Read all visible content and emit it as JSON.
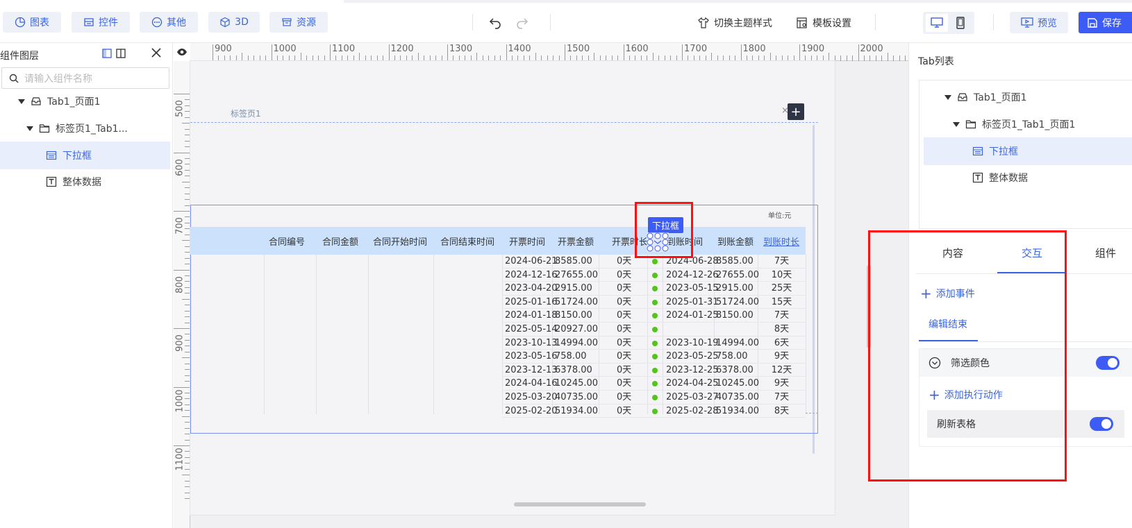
{
  "toolbar": {
    "buttons": [
      {
        "label": "图表",
        "icon": "pie-chart-icon"
      },
      {
        "label": "控件",
        "icon": "widget-icon"
      },
      {
        "label": "其他",
        "icon": "more-circle-icon"
      },
      {
        "label": "3D",
        "icon": "cube-icon"
      },
      {
        "label": "资源",
        "icon": "archive-icon"
      }
    ],
    "theme_label": "切换主题样式",
    "template_label": "模板设置",
    "preview_label": "预览",
    "save_label": "保存"
  },
  "left_panel": {
    "title": "组件图层",
    "search_placeholder": "请输入组件名称",
    "tree": [
      {
        "label": "Tab1_页面1",
        "icon": "inbox-icon"
      },
      {
        "label": "标签页1_Tab1...",
        "icon": "folder-icon"
      },
      {
        "label": "下拉框",
        "icon": "dropdown-component-icon",
        "selected": true
      },
      {
        "label": "整体数据",
        "icon": "text-component-icon"
      }
    ]
  },
  "rulers": {
    "top": [
      "900",
      "1000",
      "1100",
      "1200",
      "1300",
      "1400",
      "1500",
      "1600",
      "1700",
      "1800",
      "1900",
      "2000"
    ],
    "left": [
      "500",
      "600",
      "700",
      "800",
      "900",
      "1000",
      "1100"
    ]
  },
  "canvas": {
    "tab_label": "标签页1",
    "tab_close": "×",
    "tab_add": "+",
    "unit_label": "单位:元",
    "badge": "下拉框",
    "table": {
      "headers": [
        "合同编号",
        "合同金额",
        "合同开始时间",
        "合同结束时间",
        "开票时间",
        "开票金额",
        "开票时长",
        "到账时间",
        "到账金额",
        "到账时长"
      ],
      "rows": [
        [
          "2024-06-21",
          "8585.00",
          "0天",
          "2024-06-28",
          "8585.00",
          "7天"
        ],
        [
          "2024-12-16",
          "27655.00",
          "0天",
          "2024-12-26",
          "27655.00",
          "10天"
        ],
        [
          "2023-04-20",
          "2915.00",
          "0天",
          "2023-05-15",
          "2915.00",
          "25天"
        ],
        [
          "2025-01-16",
          "51724.00",
          "0天",
          "2025-01-31",
          "51724.00",
          "15天"
        ],
        [
          "2024-01-18",
          "8150.00",
          "0天",
          "2024-01-25",
          "8150.00",
          "7天"
        ],
        [
          "2025-05-14",
          "20927.00",
          "0天",
          "",
          "",
          "8天"
        ],
        [
          "2023-10-13",
          "14994.00",
          "0天",
          "2023-10-19",
          "14994.00",
          "6天"
        ],
        [
          "2023-05-16",
          "758.00",
          "0天",
          "2023-05-25",
          "758.00",
          "9天"
        ],
        [
          "2023-12-13",
          "6378.00",
          "0天",
          "2023-12-25",
          "6378.00",
          "12天"
        ],
        [
          "2024-04-16",
          "10245.00",
          "0天",
          "2024-04-25",
          "10245.00",
          "9天"
        ],
        [
          "2025-03-20",
          "40735.00",
          "0天",
          "2025-03-27",
          "40735.00",
          "7天"
        ],
        [
          "2025-02-20",
          "51934.00",
          "0天",
          "2025-02-28",
          "51934.00",
          "8天"
        ]
      ]
    }
  },
  "right_panel": {
    "title": "Tab列表",
    "tree": [
      {
        "label": "Tab1_页面1"
      },
      {
        "label": "标签页1_Tab1_页面1"
      },
      {
        "label": "下拉框"
      },
      {
        "label": "整体数据"
      }
    ],
    "tabs": [
      "内容",
      "交互",
      "组件"
    ],
    "active_tab": "交互",
    "add_event": "添加事件",
    "edit_end": "编辑结束",
    "event_name": "筛选颜色",
    "add_action": "添加执行动作",
    "action_name": "刷新表格"
  },
  "colors": {
    "accent": "#3d5cf5",
    "table_header": "#cce1fb",
    "status_dot": "#52c41a",
    "highlight": "#ff0f0f"
  }
}
